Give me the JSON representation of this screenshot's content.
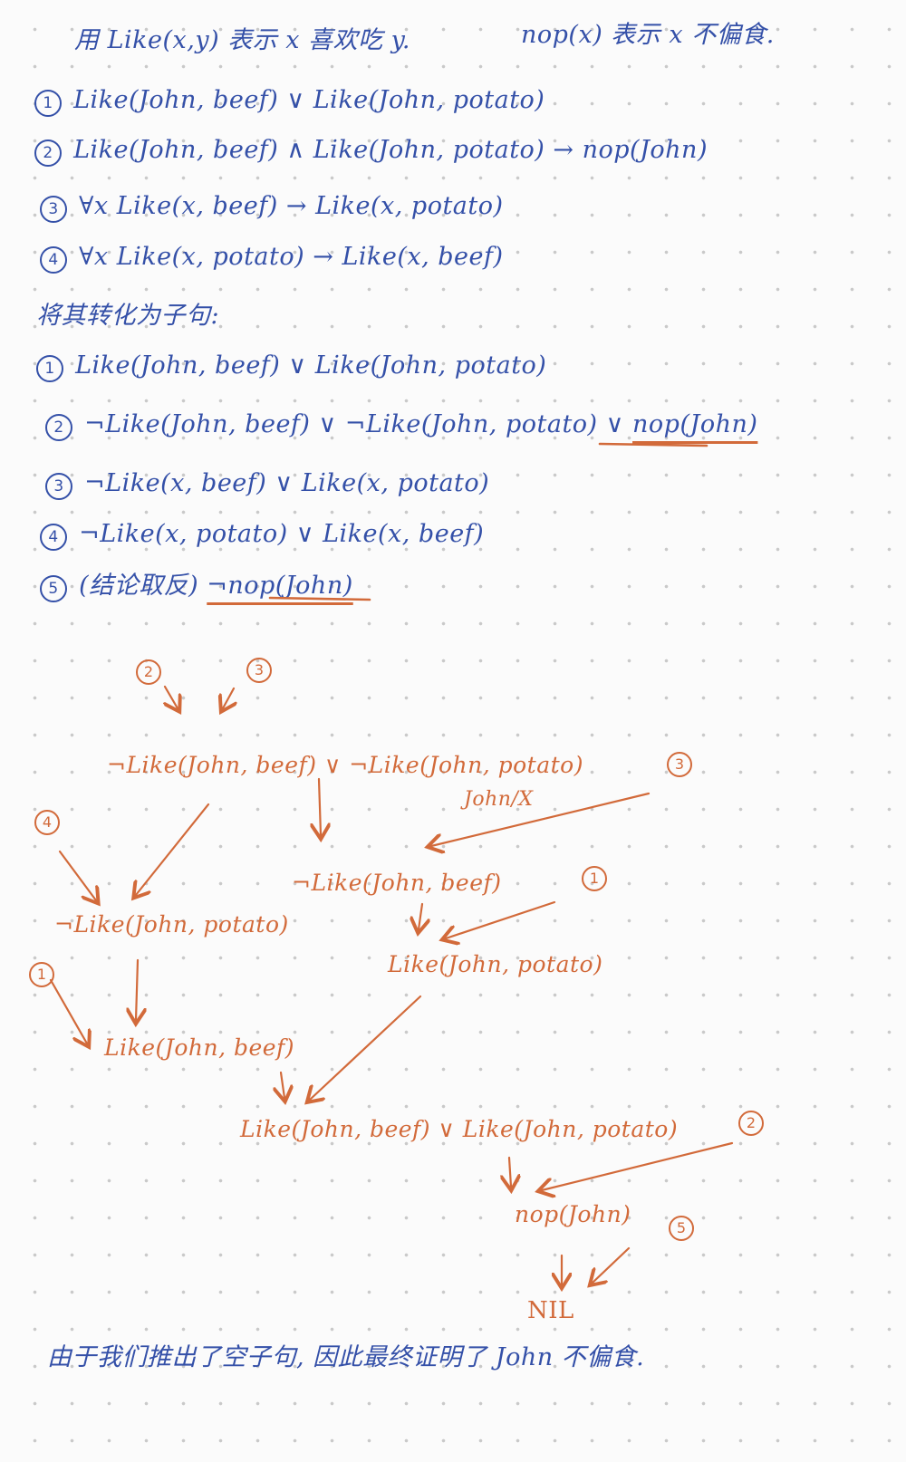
{
  "header": {
    "def_like": "用 Like(x,y) 表示 x 喜欢吃 y.",
    "def_nop": "nop(x) 表示 x 不偏食."
  },
  "premises": [
    {
      "num": "1",
      "text": "Like(John, beef) ∨ Like(John, potato)"
    },
    {
      "num": "2",
      "text": "Like(John, beef) ∧ Like(John, potato) → nop(John)"
    },
    {
      "num": "3",
      "text": "∀x  Like(x, beef) → Like(x, potato)"
    },
    {
      "num": "4",
      "text": "∀x  Like(x, potato) → Like(x, beef)"
    }
  ],
  "convert_label": "将其转化为子句:",
  "clauses": [
    {
      "num": "1",
      "text": "Like(John, beef) ∨ Like(John, potato)"
    },
    {
      "num": "2",
      "text": "¬Like(John, beef) ∨ ¬Like(John, potato) ∨",
      "tail": "nop(John)"
    },
    {
      "num": "3",
      "text": "¬Like(x, beef) ∨ Like(x, potato)"
    },
    {
      "num": "4",
      "text": "¬Like(x, potato) ∨ Like(x, beef)"
    },
    {
      "num": "5",
      "text": "(结论取反)",
      "tail": "¬nop(John)"
    }
  ],
  "tree": {
    "ref_2": "2",
    "ref_3_top": "3",
    "resolvent_1": "¬Like(John, beef) ∨ ¬Like(John, potato)",
    "subst": "John/X",
    "ref_3_right": "3",
    "ref_4": "4",
    "left_lit": "¬Like(John, potato)",
    "mid_lit": "¬Like(John, beef)",
    "ref_1_right": "1",
    "right_lit": "Like(John, potato)",
    "ref_1_left": "1",
    "left_result": "Like(John, beef)",
    "combined": "Like(John, beef) ∨ Like(John, potato)",
    "ref_2_bottom": "2",
    "nop": "nop(John)",
    "ref_5": "5",
    "nil": "NIL"
  },
  "conclusion": "由于我们推出了空子句, 因此最终证明了 John 不偏食."
}
